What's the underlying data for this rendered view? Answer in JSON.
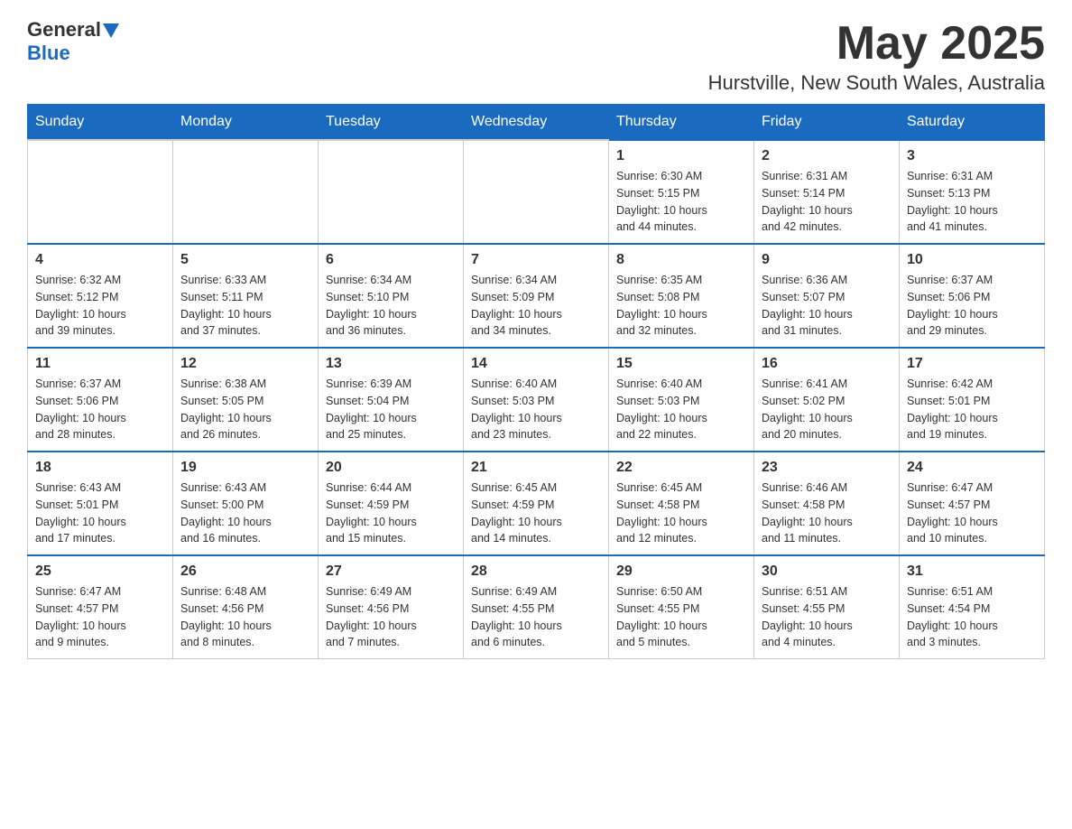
{
  "header": {
    "logo_general": "General",
    "logo_blue": "Blue",
    "month_title": "May 2025",
    "location": "Hurstville, New South Wales, Australia"
  },
  "weekdays": [
    "Sunday",
    "Monday",
    "Tuesday",
    "Wednesday",
    "Thursday",
    "Friday",
    "Saturday"
  ],
  "weeks": [
    [
      {
        "day": "",
        "info": ""
      },
      {
        "day": "",
        "info": ""
      },
      {
        "day": "",
        "info": ""
      },
      {
        "day": "",
        "info": ""
      },
      {
        "day": "1",
        "info": "Sunrise: 6:30 AM\nSunset: 5:15 PM\nDaylight: 10 hours\nand 44 minutes."
      },
      {
        "day": "2",
        "info": "Sunrise: 6:31 AM\nSunset: 5:14 PM\nDaylight: 10 hours\nand 42 minutes."
      },
      {
        "day": "3",
        "info": "Sunrise: 6:31 AM\nSunset: 5:13 PM\nDaylight: 10 hours\nand 41 minutes."
      }
    ],
    [
      {
        "day": "4",
        "info": "Sunrise: 6:32 AM\nSunset: 5:12 PM\nDaylight: 10 hours\nand 39 minutes."
      },
      {
        "day": "5",
        "info": "Sunrise: 6:33 AM\nSunset: 5:11 PM\nDaylight: 10 hours\nand 37 minutes."
      },
      {
        "day": "6",
        "info": "Sunrise: 6:34 AM\nSunset: 5:10 PM\nDaylight: 10 hours\nand 36 minutes."
      },
      {
        "day": "7",
        "info": "Sunrise: 6:34 AM\nSunset: 5:09 PM\nDaylight: 10 hours\nand 34 minutes."
      },
      {
        "day": "8",
        "info": "Sunrise: 6:35 AM\nSunset: 5:08 PM\nDaylight: 10 hours\nand 32 minutes."
      },
      {
        "day": "9",
        "info": "Sunrise: 6:36 AM\nSunset: 5:07 PM\nDaylight: 10 hours\nand 31 minutes."
      },
      {
        "day": "10",
        "info": "Sunrise: 6:37 AM\nSunset: 5:06 PM\nDaylight: 10 hours\nand 29 minutes."
      }
    ],
    [
      {
        "day": "11",
        "info": "Sunrise: 6:37 AM\nSunset: 5:06 PM\nDaylight: 10 hours\nand 28 minutes."
      },
      {
        "day": "12",
        "info": "Sunrise: 6:38 AM\nSunset: 5:05 PM\nDaylight: 10 hours\nand 26 minutes."
      },
      {
        "day": "13",
        "info": "Sunrise: 6:39 AM\nSunset: 5:04 PM\nDaylight: 10 hours\nand 25 minutes."
      },
      {
        "day": "14",
        "info": "Sunrise: 6:40 AM\nSunset: 5:03 PM\nDaylight: 10 hours\nand 23 minutes."
      },
      {
        "day": "15",
        "info": "Sunrise: 6:40 AM\nSunset: 5:03 PM\nDaylight: 10 hours\nand 22 minutes."
      },
      {
        "day": "16",
        "info": "Sunrise: 6:41 AM\nSunset: 5:02 PM\nDaylight: 10 hours\nand 20 minutes."
      },
      {
        "day": "17",
        "info": "Sunrise: 6:42 AM\nSunset: 5:01 PM\nDaylight: 10 hours\nand 19 minutes."
      }
    ],
    [
      {
        "day": "18",
        "info": "Sunrise: 6:43 AM\nSunset: 5:01 PM\nDaylight: 10 hours\nand 17 minutes."
      },
      {
        "day": "19",
        "info": "Sunrise: 6:43 AM\nSunset: 5:00 PM\nDaylight: 10 hours\nand 16 minutes."
      },
      {
        "day": "20",
        "info": "Sunrise: 6:44 AM\nSunset: 4:59 PM\nDaylight: 10 hours\nand 15 minutes."
      },
      {
        "day": "21",
        "info": "Sunrise: 6:45 AM\nSunset: 4:59 PM\nDaylight: 10 hours\nand 14 minutes."
      },
      {
        "day": "22",
        "info": "Sunrise: 6:45 AM\nSunset: 4:58 PM\nDaylight: 10 hours\nand 12 minutes."
      },
      {
        "day": "23",
        "info": "Sunrise: 6:46 AM\nSunset: 4:58 PM\nDaylight: 10 hours\nand 11 minutes."
      },
      {
        "day": "24",
        "info": "Sunrise: 6:47 AM\nSunset: 4:57 PM\nDaylight: 10 hours\nand 10 minutes."
      }
    ],
    [
      {
        "day": "25",
        "info": "Sunrise: 6:47 AM\nSunset: 4:57 PM\nDaylight: 10 hours\nand 9 minutes."
      },
      {
        "day": "26",
        "info": "Sunrise: 6:48 AM\nSunset: 4:56 PM\nDaylight: 10 hours\nand 8 minutes."
      },
      {
        "day": "27",
        "info": "Sunrise: 6:49 AM\nSunset: 4:56 PM\nDaylight: 10 hours\nand 7 minutes."
      },
      {
        "day": "28",
        "info": "Sunrise: 6:49 AM\nSunset: 4:55 PM\nDaylight: 10 hours\nand 6 minutes."
      },
      {
        "day": "29",
        "info": "Sunrise: 6:50 AM\nSunset: 4:55 PM\nDaylight: 10 hours\nand 5 minutes."
      },
      {
        "day": "30",
        "info": "Sunrise: 6:51 AM\nSunset: 4:55 PM\nDaylight: 10 hours\nand 4 minutes."
      },
      {
        "day": "31",
        "info": "Sunrise: 6:51 AM\nSunset: 4:54 PM\nDaylight: 10 hours\nand 3 minutes."
      }
    ]
  ]
}
